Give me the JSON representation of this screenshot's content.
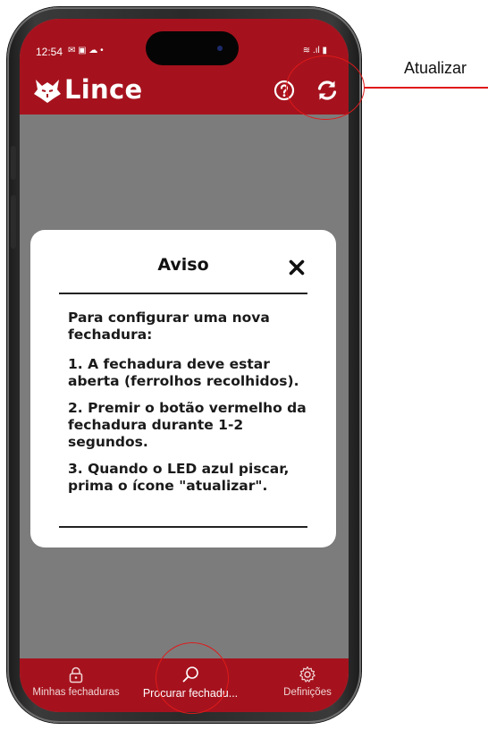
{
  "status_bar": {
    "time": "12:54",
    "notification_icons": "✉ ▣ ☁ •",
    "right_icons": "≋ .ıl ▮"
  },
  "header": {
    "app_name": "Lince",
    "help_icon": "help-circle-icon",
    "refresh_icon": "refresh-icon"
  },
  "dialog": {
    "title": "Aviso",
    "intro": "Para configurar uma nova fechadura:",
    "steps": [
      "1. A fechadura deve estar aberta (ferrolhos recolhidos).",
      "2. Premir o botão vermelho da fechadura durante 1-2 segundos.",
      "3. Quando o LED azul piscar, prima o ícone \"atualizar\"."
    ]
  },
  "bottom_nav": {
    "items": [
      {
        "label": "Minhas fechaduras",
        "icon": "padlock-icon"
      },
      {
        "label": "Procurar fechadu...",
        "icon": "search-icon",
        "active": true
      },
      {
        "label": "Definições",
        "icon": "gear-icon"
      }
    ]
  },
  "annotation": {
    "label": "Atualizar"
  },
  "colors": {
    "brand_red": "#a5121d",
    "overlay_gray": "#7c7c7c",
    "annotation_red": "#e01a1a"
  }
}
